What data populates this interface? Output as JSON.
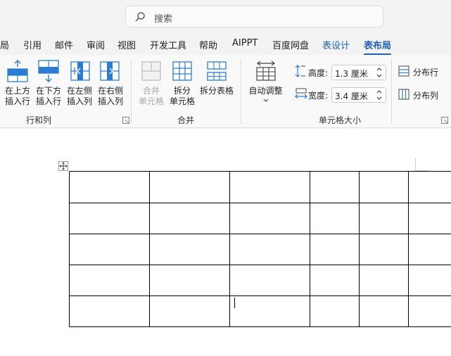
{
  "search": {
    "placeholder": "搜索",
    "icon": "search-icon"
  },
  "tabs": [
    {
      "label": "局",
      "state": "normal"
    },
    {
      "label": "引用",
      "state": "normal"
    },
    {
      "label": "邮件",
      "state": "normal"
    },
    {
      "label": "审阅",
      "state": "normal"
    },
    {
      "label": "视图",
      "state": "normal"
    },
    {
      "label": "开发工具",
      "state": "normal"
    },
    {
      "label": "帮助",
      "state": "normal"
    },
    {
      "label": "AIPPT",
      "state": "normal"
    },
    {
      "label": "百度网盘",
      "state": "normal"
    },
    {
      "label": "表设计",
      "state": "contextual"
    },
    {
      "label": "表布局",
      "state": "active"
    }
  ],
  "ribbon": {
    "rows_cols": {
      "label": "行和列",
      "insert_above": [
        "在上方",
        "插入行"
      ],
      "insert_below": [
        "在下方",
        "插入行"
      ],
      "insert_left": [
        "在左侧",
        "插入列"
      ],
      "insert_right": [
        "在右侧",
        "插入列"
      ]
    },
    "merge": {
      "label": "合并",
      "merge_cells": [
        "合并",
        "单元格"
      ],
      "split_cells": [
        "拆分",
        "单元格"
      ],
      "split_table": "拆分表格"
    },
    "cell_size": {
      "label": "单元格大小",
      "autofit": "自动调整",
      "height_label": "高度:",
      "height_value": "1.3 厘米",
      "width_label": "宽度:",
      "width_value": "3.4 厘米",
      "distribute_rows": "分布行",
      "distribute_cols": "分布列"
    }
  },
  "colors": {
    "accent": "#1f5fb4",
    "icon_blue": "#2b7cd3",
    "icon_light": "#9cc7ef"
  },
  "document": {
    "table_rows": 5,
    "table_cols": 6
  }
}
